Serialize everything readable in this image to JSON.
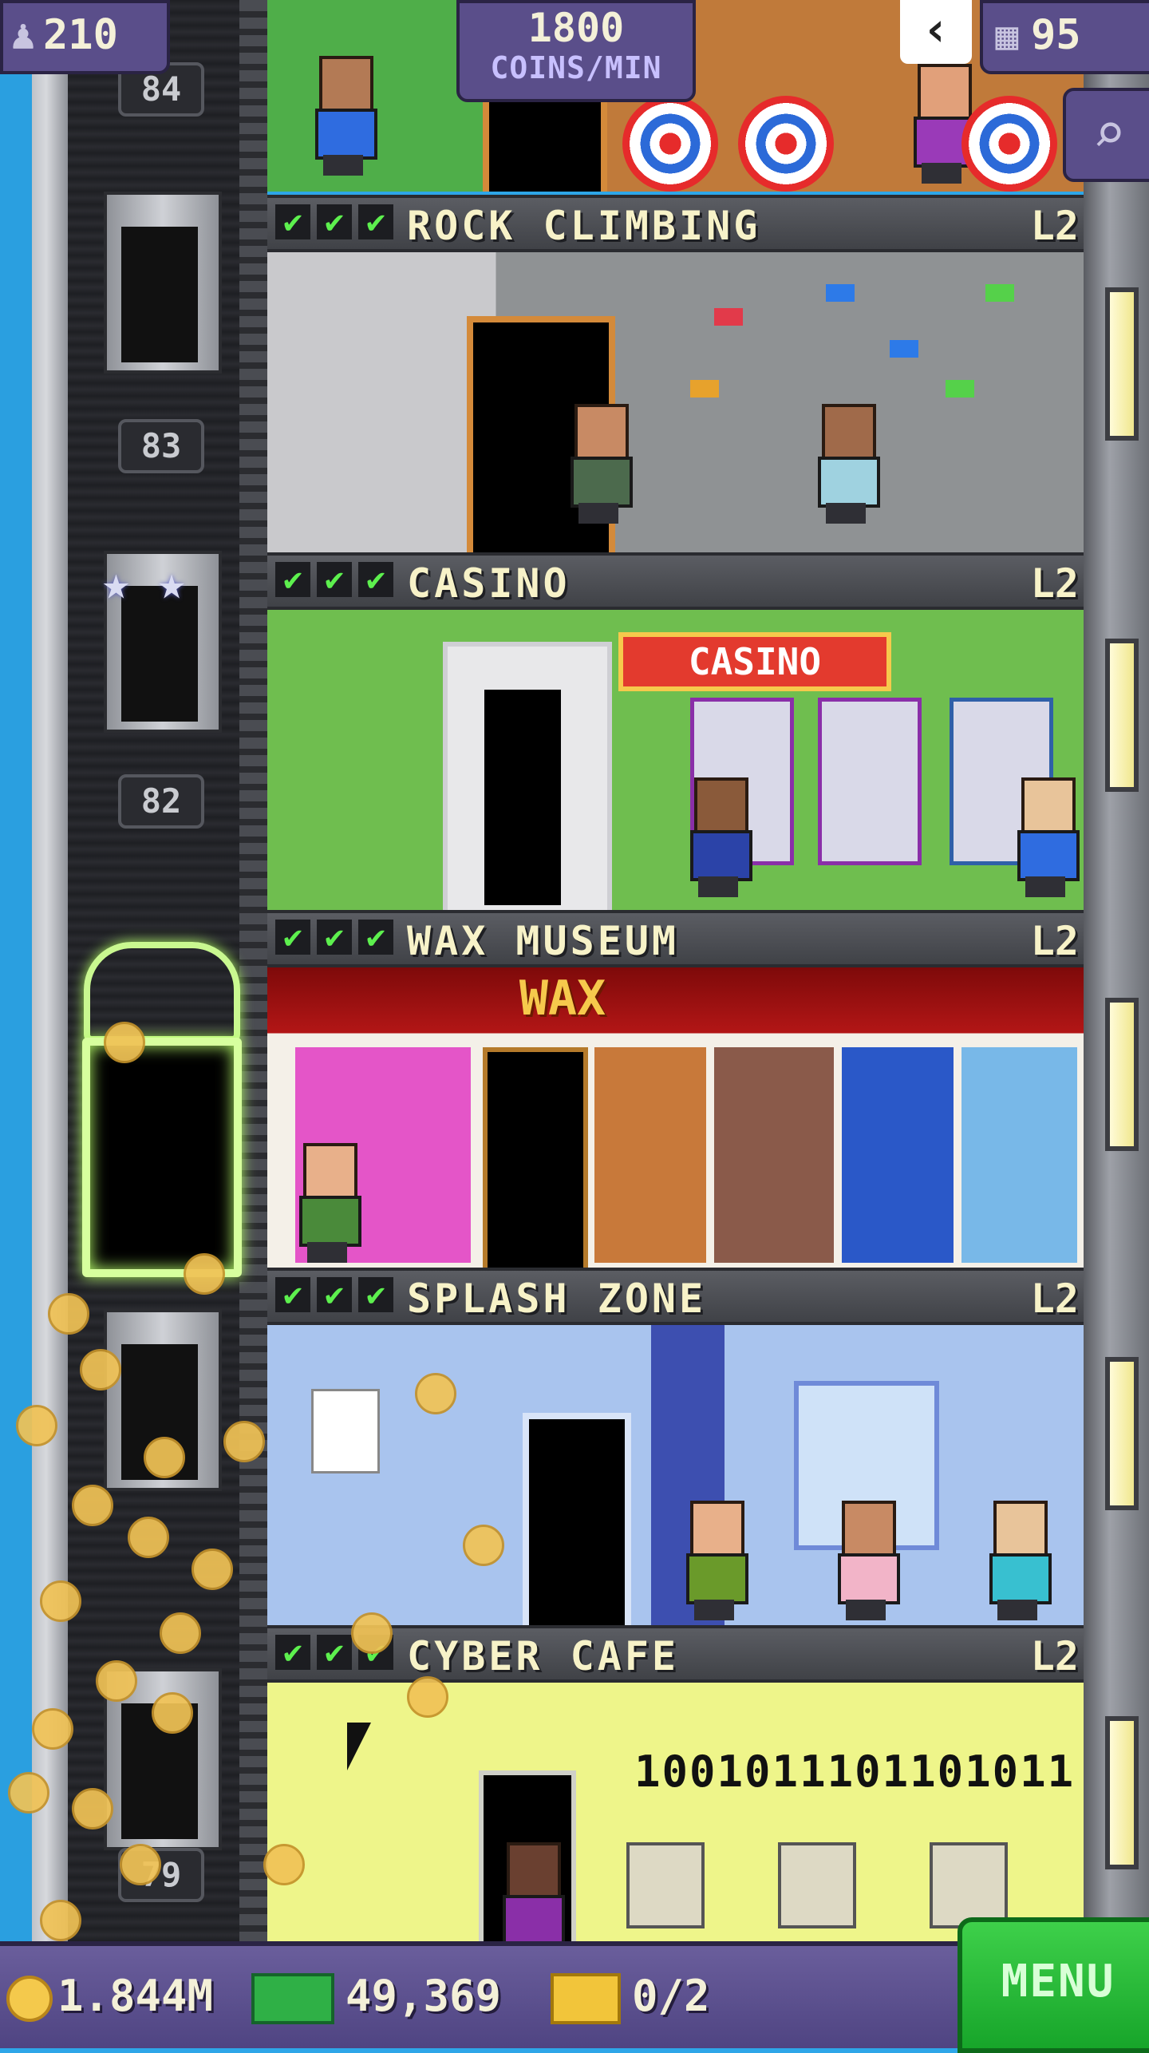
{
  "hud": {
    "population": "210",
    "coins_per_min_value": "1800",
    "coins_per_min_label": "COINS/MIN",
    "floor_count": "95",
    "back_glyph": "‹",
    "search_icon": "magnifier-icon",
    "population_icon": "person-icon",
    "floors_icon": "building-icon"
  },
  "elevator": {
    "floor_numbers": [
      "84",
      "83",
      "82",
      "79"
    ]
  },
  "floors": [
    {
      "name": "ROCK CLIMBING",
      "level": "L2"
    },
    {
      "name": "CASINO",
      "level": "L2",
      "sign": "CASINO"
    },
    {
      "name": "WAX MUSEUM",
      "level": "L2",
      "sign": "WAX"
    },
    {
      "name": "SPLASH ZONE",
      "level": "L2"
    },
    {
      "name": "CYBER CAFE",
      "level": "L2",
      "screen_text": "1001011101101011"
    }
  ],
  "check_glyph": "✔",
  "star_glyph": "★",
  "bottom_bar": {
    "coins": "1.844M",
    "bux": "49,369",
    "tickets": "0/2",
    "menu_label": "MENU"
  },
  "colors": {
    "hud_purple": "#5a4e8a",
    "menu_green": "#2dbb3a",
    "header_gray": "#4d4f55",
    "neon_green": "#d7ff9e"
  }
}
